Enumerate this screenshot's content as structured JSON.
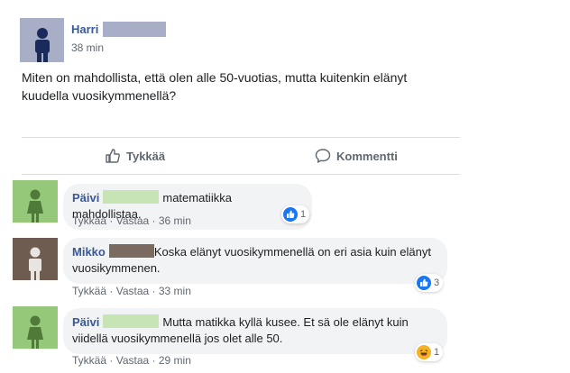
{
  "post": {
    "author": "Harri",
    "time": "38 min",
    "text": "Miten on mahdollista, että olen alle 50-vuotias, mutta kuitenkin elänyt kuudella vuosikymmenellä?"
  },
  "actions": {
    "like_label": "Tykkää",
    "comment_label": "Kommentti"
  },
  "meta_labels": {
    "like": "Tykkää",
    "reply": "Vastaa",
    "separator": "·"
  },
  "comments": [
    {
      "author": "Päivi",
      "text": "matematiikka mahdollistaa.",
      "time": "36 min",
      "reaction": "like",
      "reaction_count": "1",
      "avatar_color": "#96c87a",
      "redact_color": "#c6e4b4"
    },
    {
      "author": "Mikko",
      "text": "Koska elänyt vuosikymmenellä on eri asia kuin elänyt vuosikymmenen.",
      "time": "33 min",
      "reaction": "like",
      "reaction_count": "3",
      "avatar_color": "#6e5c51",
      "redact_color": "#7a6a60"
    },
    {
      "author": "Päivi",
      "text": "Mutta matikka kyllä kusee. Et sä ole elänyt kuin viidellä vuosikymmenellä jos olet alle 50.",
      "time": "29 min",
      "reaction": "haha",
      "reaction_count": "1",
      "avatar_color": "#96c87a",
      "redact_color": "#c6e4b4"
    }
  ],
  "colors": {
    "link_blue": "#385898",
    "like_blue": "#1877f2",
    "haha_yellow": "#f7b125",
    "post_avatar": "#a7aec6",
    "post_redact": "#a7aec6"
  }
}
